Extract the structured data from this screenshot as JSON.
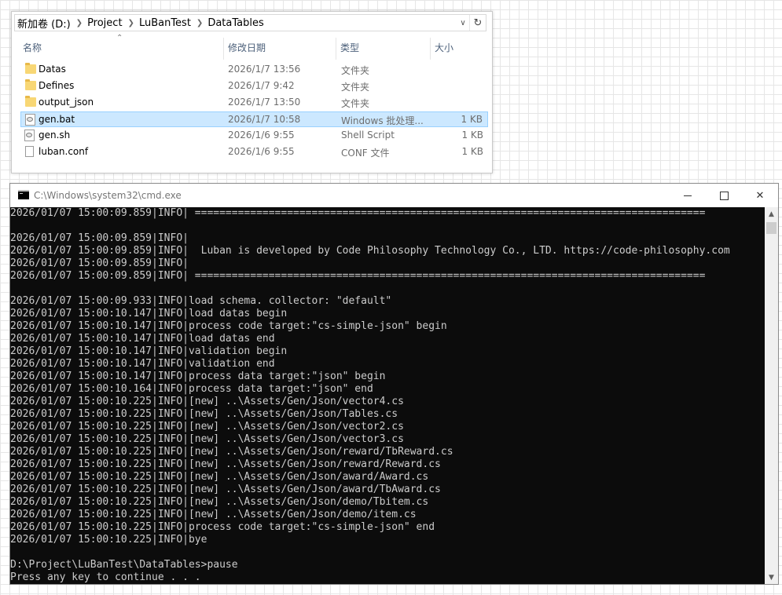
{
  "explorer": {
    "breadcrumb": [
      "新加卷 (D:)",
      "Project",
      "LuBanTest",
      "DataTables"
    ],
    "columns": {
      "name": "名称",
      "date": "修改日期",
      "type": "类型",
      "size": "大小"
    },
    "files": [
      {
        "name": "Datas",
        "date": "2026/1/7 13:56",
        "type": "文件夹",
        "size": "",
        "icon": "folder-icon",
        "selected": false
      },
      {
        "name": "Defines",
        "date": "2026/1/7 9:42",
        "type": "文件夹",
        "size": "",
        "icon": "folder-icon",
        "selected": false
      },
      {
        "name": "output_json",
        "date": "2026/1/7 13:50",
        "type": "文件夹",
        "size": "",
        "icon": "folder-icon",
        "selected": false
      },
      {
        "name": "gen.bat",
        "date": "2026/1/7 10:58",
        "type": "Windows 批处理...",
        "size": "1 KB",
        "icon": "batch-file-icon",
        "selected": true
      },
      {
        "name": "gen.sh",
        "date": "2026/1/6 9:55",
        "type": "Shell Script",
        "size": "1 KB",
        "icon": "script-file-icon",
        "selected": false
      },
      {
        "name": "luban.conf",
        "date": "2026/1/6 9:55",
        "type": "CONF 文件",
        "size": "1 KB",
        "icon": "file-icon",
        "selected": false
      }
    ]
  },
  "cmd": {
    "title": "C:\\Windows\\system32\\cmd.exe",
    "lines": [
      "2026/01/07 15:00:09.859|INFO| ===================================================================================",
      "",
      "2026/01/07 15:00:09.859|INFO|",
      "2026/01/07 15:00:09.859|INFO|  Luban is developed by Code Philosophy Technology Co., LTD. https://code-philosophy.com",
      "2026/01/07 15:00:09.859|INFO|",
      "2026/01/07 15:00:09.859|INFO| ===================================================================================",
      "",
      "2026/01/07 15:00:09.933|INFO|load schema. collector: \"default\"",
      "2026/01/07 15:00:10.147|INFO|load datas begin",
      "2026/01/07 15:00:10.147|INFO|process code target:\"cs-simple-json\" begin",
      "2026/01/07 15:00:10.147|INFO|load datas end",
      "2026/01/07 15:00:10.147|INFO|validation begin",
      "2026/01/07 15:00:10.147|INFO|validation end",
      "2026/01/07 15:00:10.147|INFO|process data target:\"json\" begin",
      "2026/01/07 15:00:10.164|INFO|process data target:\"json\" end",
      "2026/01/07 15:00:10.225|INFO|[new] ..\\Assets/Gen/Json/vector4.cs",
      "2026/01/07 15:00:10.225|INFO|[new] ..\\Assets/Gen/Json/Tables.cs",
      "2026/01/07 15:00:10.225|INFO|[new] ..\\Assets/Gen/Json/vector2.cs",
      "2026/01/07 15:00:10.225|INFO|[new] ..\\Assets/Gen/Json/vector3.cs",
      "2026/01/07 15:00:10.225|INFO|[new] ..\\Assets/Gen/Json/reward/TbReward.cs",
      "2026/01/07 15:00:10.225|INFO|[new] ..\\Assets/Gen/Json/reward/Reward.cs",
      "2026/01/07 15:00:10.225|INFO|[new] ..\\Assets/Gen/Json/award/Award.cs",
      "2026/01/07 15:00:10.225|INFO|[new] ..\\Assets/Gen/Json/award/TbAward.cs",
      "2026/01/07 15:00:10.225|INFO|[new] ..\\Assets/Gen/Json/demo/Tbitem.cs",
      "2026/01/07 15:00:10.225|INFO|[new] ..\\Assets/Gen/Json/demo/item.cs",
      "2026/01/07 15:00:10.225|INFO|process code target:\"cs-simple-json\" end",
      "2026/01/07 15:00:10.225|INFO|bye",
      "",
      "D:\\Project\\LuBanTest\\DataTables>pause",
      "Press any key to continue . . ."
    ]
  }
}
